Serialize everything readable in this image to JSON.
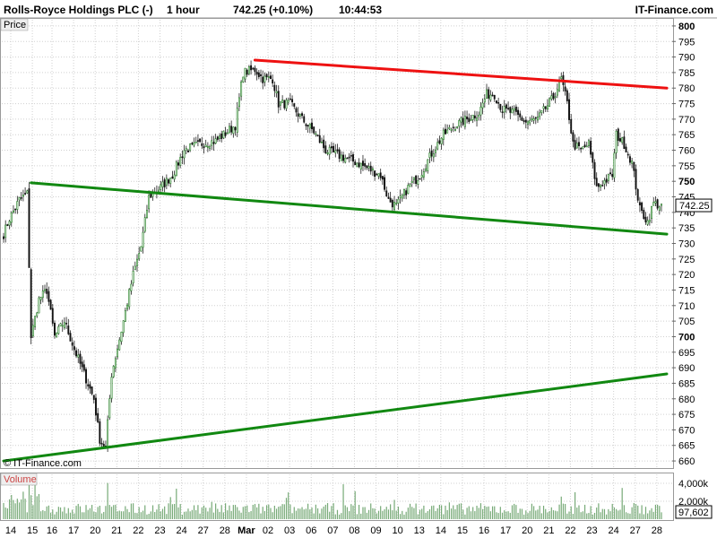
{
  "header": {
    "title": "Rolls-Royce Holdings PLC (-)",
    "interval": "1 hour",
    "price_change": "742.25 (+0.10%)",
    "time": "10:44:53",
    "brand": "IT-Finance.com"
  },
  "panels": {
    "price_label": "Price",
    "volume_label": "Volume",
    "watermark": "© IT-Finance.com"
  },
  "colors": {
    "up": "#1a7a1a",
    "down": "#cc1111",
    "resistance": "#ee1111",
    "support": "#118811",
    "grid": "#d0d0d0",
    "last_price_bg": "#ffffff",
    "volume_bar": "#77aa77"
  },
  "chart_data": {
    "type": "candlestick",
    "ylim": [
      658,
      802
    ],
    "y_ticks": [
      660,
      665,
      670,
      675,
      680,
      685,
      690,
      695,
      700,
      705,
      710,
      715,
      720,
      725,
      730,
      735,
      740,
      745,
      750,
      755,
      760,
      765,
      770,
      775,
      780,
      785,
      790,
      795,
      800
    ],
    "y_bold_ticks": [
      700,
      750,
      800
    ],
    "x_labels": [
      "14",
      "15",
      "16",
      "17",
      "20",
      "21",
      "22",
      "23",
      "24",
      "27",
      "28",
      "Mar",
      "02",
      "03",
      "06",
      "07",
      "08",
      "09",
      "10",
      "13",
      "14",
      "15",
      "16",
      "17",
      "20",
      "21",
      "22",
      "23",
      "24",
      "27",
      "28"
    ],
    "x_label_index": [
      0,
      11,
      21,
      32,
      43,
      54,
      65,
      76,
      87,
      98,
      109,
      120,
      131,
      142,
      153,
      164,
      175,
      186,
      197,
      208,
      219,
      230,
      241,
      252,
      263,
      274,
      285,
      296,
      307,
      318,
      329
    ],
    "n_bars": 336,
    "last_price": 742.25,
    "last_price_label": "742.25",
    "volume_ylim": [
      0,
      5000
    ],
    "volume_ticks": [
      {
        "v": 2000,
        "label": "2,000k"
      },
      {
        "v": 4000,
        "label": "4,000k"
      }
    ],
    "volume_last_label": "97,602",
    "close_keypoints": [
      [
        0,
        733
      ],
      [
        3,
        738
      ],
      [
        8,
        744
      ],
      [
        12,
        746
      ],
      [
        14,
        700
      ],
      [
        18,
        712
      ],
      [
        22,
        715
      ],
      [
        26,
        700
      ],
      [
        31,
        705
      ],
      [
        36,
        696
      ],
      [
        41,
        688
      ],
      [
        46,
        680
      ],
      [
        49,
        667
      ],
      [
        52,
        664
      ],
      [
        55,
        688
      ],
      [
        60,
        702
      ],
      [
        66,
        720
      ],
      [
        70,
        729
      ],
      [
        74,
        745
      ],
      [
        80,
        748
      ],
      [
        86,
        752
      ],
      [
        92,
        760
      ],
      [
        100,
        762
      ],
      [
        108,
        763
      ],
      [
        114,
        766
      ],
      [
        118,
        768
      ],
      [
        122,
        785
      ],
      [
        128,
        786
      ],
      [
        132,
        783
      ],
      [
        137,
        783
      ],
      [
        140,
        775
      ],
      [
        146,
        775
      ],
      [
        152,
        770
      ],
      [
        158,
        766
      ],
      [
        164,
        760
      ],
      [
        172,
        758
      ],
      [
        180,
        756
      ],
      [
        186,
        754
      ],
      [
        192,
        752
      ],
      [
        196,
        744
      ],
      [
        200,
        742
      ],
      [
        206,
        748
      ],
      [
        212,
        752
      ],
      [
        218,
        759
      ],
      [
        224,
        765
      ],
      [
        230,
        768
      ],
      [
        236,
        770
      ],
      [
        242,
        772
      ],
      [
        246,
        778
      ],
      [
        250,
        778
      ],
      [
        254,
        773
      ],
      [
        260,
        772
      ],
      [
        266,
        769
      ],
      [
        272,
        770
      ],
      [
        280,
        777
      ],
      [
        284,
        783
      ],
      [
        287,
        775
      ],
      [
        290,
        762
      ],
      [
        294,
        760
      ],
      [
        298,
        762
      ],
      [
        302,
        748
      ],
      [
        306,
        750
      ],
      [
        310,
        752
      ],
      [
        312,
        765
      ],
      [
        316,
        762
      ],
      [
        320,
        756
      ],
      [
        324,
        741
      ],
      [
        328,
        737
      ],
      [
        331,
        743
      ],
      [
        335,
        742
      ]
    ],
    "trendlines": [
      {
        "role": "resistance",
        "from": [
          128,
          789
        ],
        "to": [
          335,
          780
        ]
      },
      {
        "role": "support",
        "from": [
          14,
          749.5
        ],
        "to": [
          335,
          733
        ]
      },
      {
        "role": "support",
        "from": [
          0,
          660
        ],
        "to": [
          335,
          688
        ]
      }
    ]
  }
}
